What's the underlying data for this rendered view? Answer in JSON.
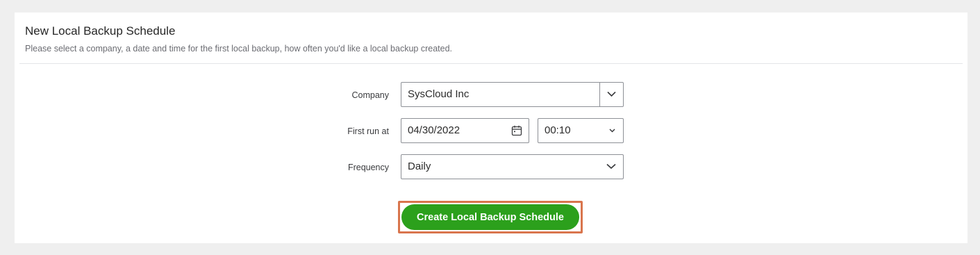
{
  "header": {
    "title": "New Local Backup Schedule",
    "subtitle": "Please select a company, a date and time for the first local backup, how often you'd like a local backup created."
  },
  "form": {
    "company": {
      "label": "Company",
      "value": "SysCloud Inc"
    },
    "first_run": {
      "label": "First run at",
      "date": "04/30/2022",
      "time": "00:10"
    },
    "frequency": {
      "label": "Frequency",
      "value": "Daily"
    }
  },
  "actions": {
    "create_label": "Create Local Backup Schedule"
  },
  "colors": {
    "accent_green": "#2ca01c",
    "highlight_border": "#d9754d"
  },
  "icons": [
    "chevron-down-icon",
    "calendar-icon"
  ]
}
